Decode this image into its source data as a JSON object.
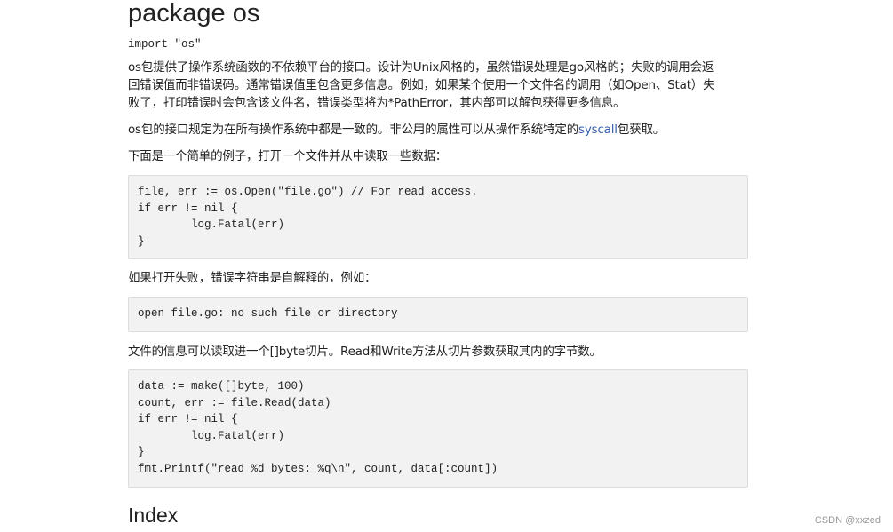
{
  "title": "package os",
  "import_line": "import \"os\"",
  "paragraphs": {
    "p1_line1": "os包提供了操作系统函数的不依赖平台的接口。设计为Unix风格的，虽然错误处理是go风格的；失败的调用会返",
    "p1_line2": "回错误值而非错误码。通常错误值里包含更多信息。例如，如果某个使用一个文件名的调用（如Open、Stat）失",
    "p1_line3": "败了，打印错误时会包含该文件名，错误类型将为*PathError，其内部可以解包获得更多信息。",
    "p2_before": "os包的接口规定为在所有操作系统中都是一致的。非公用的属性可以从操作系统特定的",
    "p2_link": "syscall",
    "p2_after": "包获取。",
    "p3": "下面是一个简单的例子，打开一个文件并从中读取一些数据：",
    "p4": "如果打开失败，错误字符串是自解释的，例如：",
    "p5": "文件的信息可以读取进一个[]byte切片。Read和Write方法从切片参数获取其内的字节数。"
  },
  "code_blocks": [
    {
      "lines": [
        "file, err := os.Open(\"file.go\") // For read access.",
        "if err != nil {",
        "        log.Fatal(err)",
        "}"
      ]
    },
    {
      "lines": [
        "open file.go: no such file or directory"
      ]
    },
    {
      "lines": [
        "data := make([]byte, 100)",
        "count, err := file.Read(data)",
        "if err != nil {",
        "        log.Fatal(err)",
        "}",
        "fmt.Printf(\"read %d bytes: %q\\n\", count, data[:count])"
      ]
    }
  ],
  "index_heading": "Index",
  "watermark": "CSDN @xxzed",
  "colors": {
    "text": "#222222",
    "link": "#375eab",
    "code_bg": "#f2f2f2",
    "code_border": "#dddddd",
    "watermark": "#999999"
  }
}
